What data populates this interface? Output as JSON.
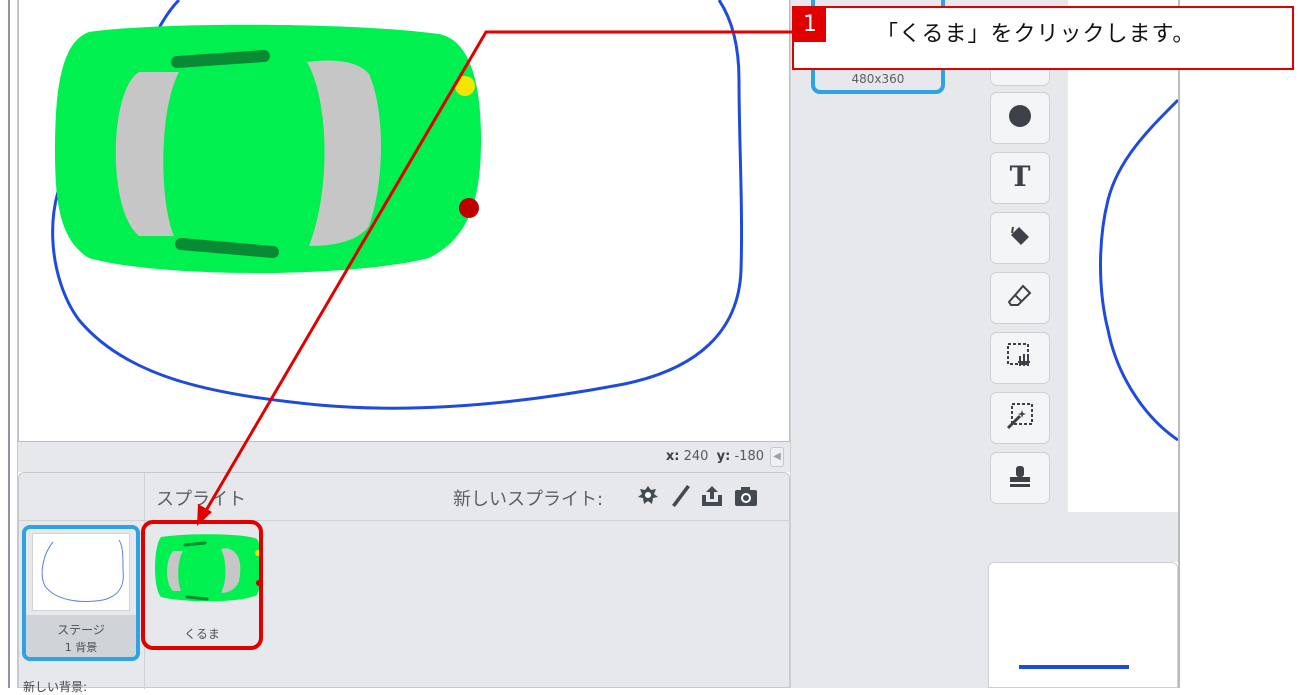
{
  "stage": {
    "coords": {
      "x_label": "x:",
      "x_value": "240",
      "y_label": "y:",
      "y_value": "-180"
    }
  },
  "sprite_panel": {
    "title": "スプライト",
    "new_sprite_label": "新しいスプライト:",
    "tools": [
      "choose-sprite-icon",
      "paint-brush-icon",
      "upload-icon",
      "camera-icon"
    ],
    "stage_thumb": {
      "name": "ステージ",
      "subtitle": "1 背景"
    },
    "sprites": [
      {
        "name": "くるま"
      }
    ],
    "new_backdrop_label": "新しい背景:"
  },
  "costume": {
    "size": "480x360"
  },
  "paint_tools": [
    "ellipse-icon",
    "text-icon",
    "fill-bucket-icon",
    "eraser-icon",
    "select-icon",
    "select-remove-background-icon",
    "stamp-icon"
  ],
  "callout": {
    "number": "1",
    "text": "「くるま」をクリックします。"
  },
  "colors": {
    "accent": "#2ea2e3",
    "annotation": "#e00000",
    "car_body": "#00f050",
    "panel_bg": "#e6e8eb",
    "track": "#1f4bdc"
  }
}
